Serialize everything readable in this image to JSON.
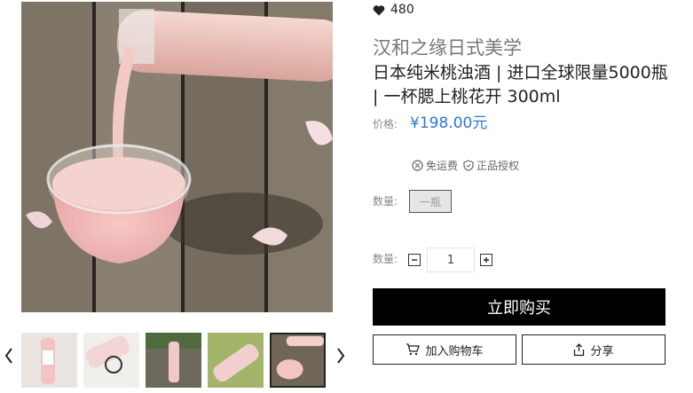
{
  "product": {
    "likes": "480",
    "brand": "汉和之缘日式美学",
    "name": "日本纯米桃浊酒 | 进口全球限量5000瓶 | 一杯腮上桃花开 300ml",
    "price_label": "价格:",
    "price": "¥198.00元",
    "services": [
      "免运费",
      "正品授权"
    ]
  },
  "options": {
    "variant_label": "数量:",
    "variant_value": "一瓶",
    "quantity_label": "数量:",
    "quantity": "1"
  },
  "actions": {
    "buy_now": "立即购买",
    "add_to_cart": "加入购物车",
    "share": "分享"
  },
  "icons": {
    "likes": "heart-icon",
    "free_shipping": "shipping-icon",
    "authentic": "shield-icon",
    "cart": "cart-icon",
    "share": "share-icon",
    "prev": "chevron-left-icon",
    "next": "chevron-right-icon"
  },
  "colors": {
    "price": "#2b78d8",
    "buy_button": "#000000"
  }
}
